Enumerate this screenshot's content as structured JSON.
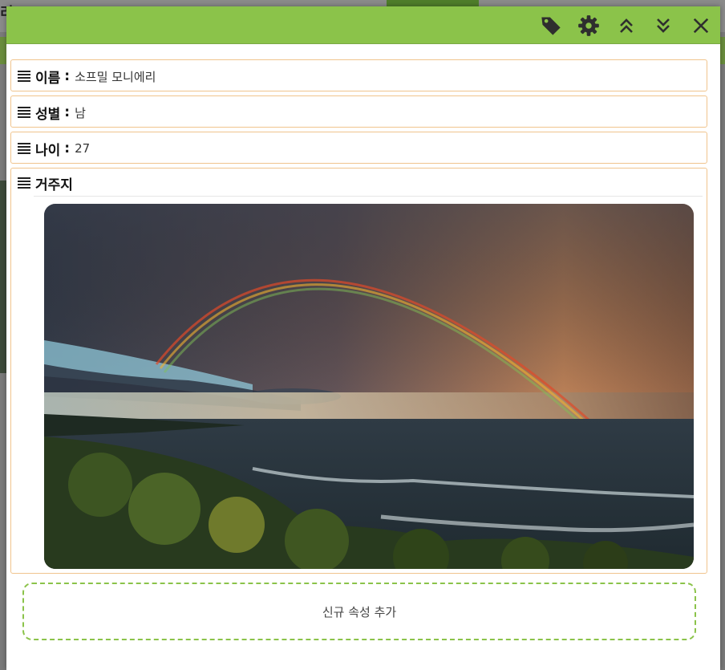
{
  "background": {
    "title_fragment": "리"
  },
  "toolbar": {
    "tag_icon": "tag-icon",
    "settings_icon": "gear-icon",
    "expand_all_icon": "chevrons-up-icon",
    "collapse_all_icon": "chevrons-down-icon",
    "close_icon": "close-icon",
    "header_color": "#8bc34a"
  },
  "fields": [
    {
      "label": "이름",
      "value": "소프밀 모니에리"
    },
    {
      "label": "성별",
      "value": "남"
    },
    {
      "label": "나이",
      "value": "27"
    },
    {
      "label": "거주지",
      "value": ""
    }
  ],
  "add_attribute_label": "신규 속성 추가",
  "colors": {
    "field_border": "#f0c48d",
    "add_border": "#8bc34a"
  }
}
